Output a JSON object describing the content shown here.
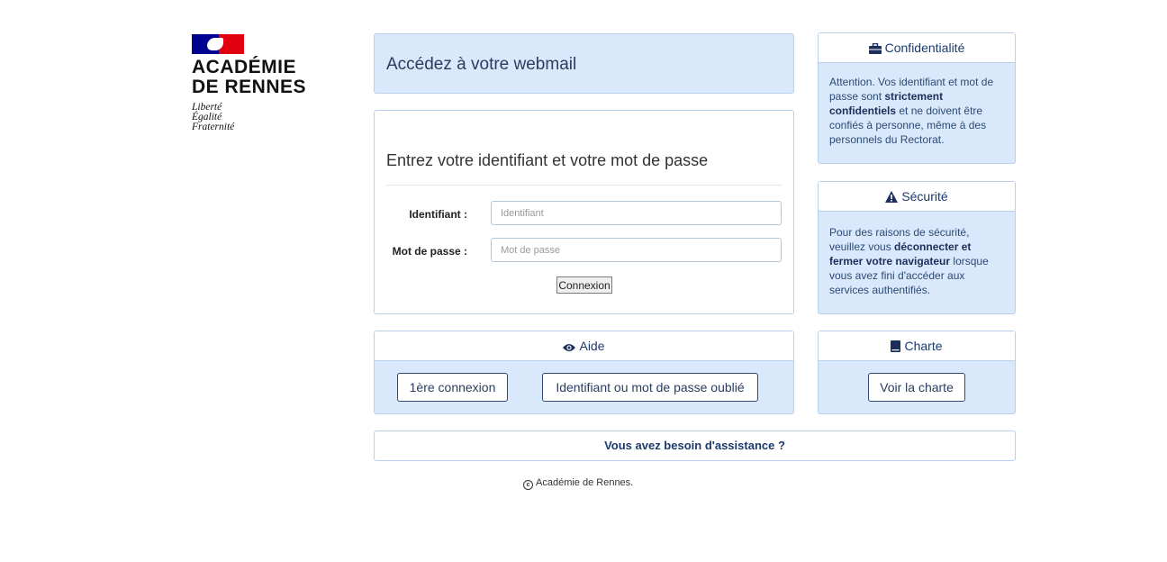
{
  "logo": {
    "title_line1": "ACADÉMIE",
    "title_line2": "DE RENNES",
    "motto1": "Liberté",
    "motto2": "Égalité",
    "motto3": "Fraternité"
  },
  "header": {
    "title": "Accédez à votre webmail"
  },
  "login": {
    "heading": "Entrez votre identifiant et votre mot de passe",
    "username_label": "Identifiant :",
    "username_placeholder": "Identifiant",
    "username_value": "",
    "password_label": "Mot de passe :",
    "password_placeholder": "Mot de passe",
    "password_value": "",
    "submit_label": "Connexion"
  },
  "confidentiality": {
    "title": "Confidentialité",
    "icon": "briefcase-icon",
    "text_pre": "Attention. Vos identifiant et mot de passe sont ",
    "text_bold": "strictement confidentiels",
    "text_post": " et ne doivent être confiés à personne, même à des personnels du Rectorat."
  },
  "security": {
    "title": "Sécurité",
    "icon": "warning-icon",
    "text_pre": "Pour des raisons de sécurité, veuillez vous ",
    "text_bold": "déconnecter et fermer votre navigateur",
    "text_post": " lorsque vous avez fini d'accéder aux services authentifiés."
  },
  "help": {
    "title": "Aide",
    "icon": "eye-icon",
    "first_login_label": "1ère connexion",
    "forgot_label": "Identifiant ou mot de passe oublié"
  },
  "charter": {
    "title": "Charte",
    "icon": "book-icon",
    "view_label": "Voir la charte"
  },
  "assistance": {
    "label": "Vous avez besoin d'assistance ?"
  },
  "footer": {
    "copyright": "Académie de Rennes."
  },
  "colors": {
    "panel_blue": "#d9e8fb",
    "border": "#b7d0ec",
    "navy": "#1c3a6b"
  }
}
